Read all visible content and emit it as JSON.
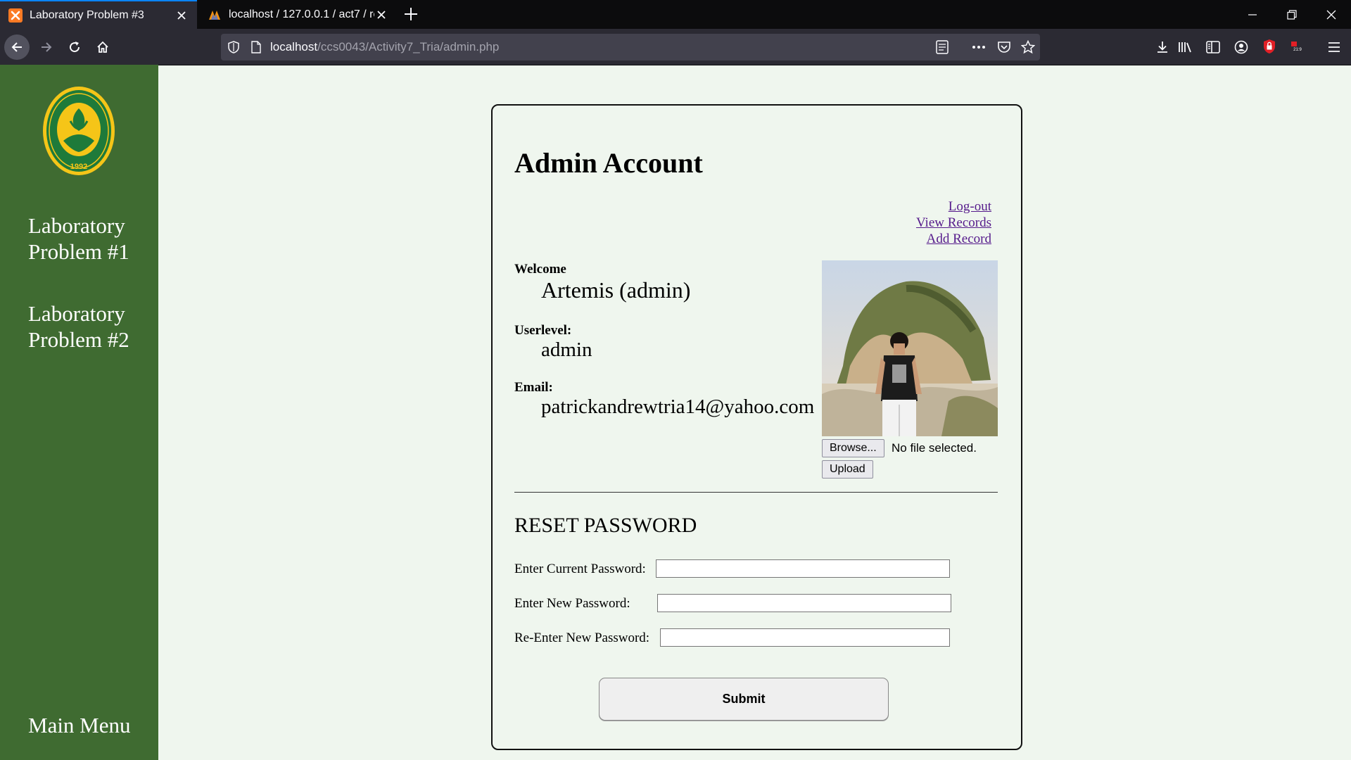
{
  "browser": {
    "tabs": [
      {
        "title": "Laboratory Problem #3",
        "active": true,
        "icon": "xampp-icon"
      },
      {
        "title": "localhost / 127.0.0.1 / act7 / reg",
        "active": false,
        "icon": "phpmyadmin-icon"
      }
    ],
    "url_host": "localhost",
    "url_path": "/ccs0043/Activity7_Tria/admin.php",
    "accent": "#0a84ff"
  },
  "sidebar": {
    "bg": "#3f6b31",
    "logo_text": "FEU INSTITUTE OF TECHNOLOGY",
    "logo_year": "1992",
    "items": [
      {
        "label": "Laboratory Problem #1"
      },
      {
        "label": "Laboratory Problem #2"
      }
    ],
    "main_menu": "Main Menu"
  },
  "card": {
    "title": "Admin Account",
    "links": [
      "Log-out",
      "View Records",
      "Add Record"
    ],
    "welcome_label": "Welcome",
    "welcome_value": "Artemis (admin)",
    "userlevel_label": "Userlevel:",
    "userlevel_value": "admin",
    "email_label": "Email:",
    "email_value": "patrickandrewtria14@yahoo.com",
    "browse_label": "Browse...",
    "file_status": "No file selected.",
    "upload_label": "Upload"
  },
  "reset": {
    "title": "RESET PASSWORD",
    "current_label": "Enter Current Password:",
    "new_label": "Enter New Password:",
    "reenter_label": "Re-Enter New Password:",
    "current_value": "",
    "new_value": "",
    "reenter_value": "",
    "submit_label": "Submit"
  }
}
